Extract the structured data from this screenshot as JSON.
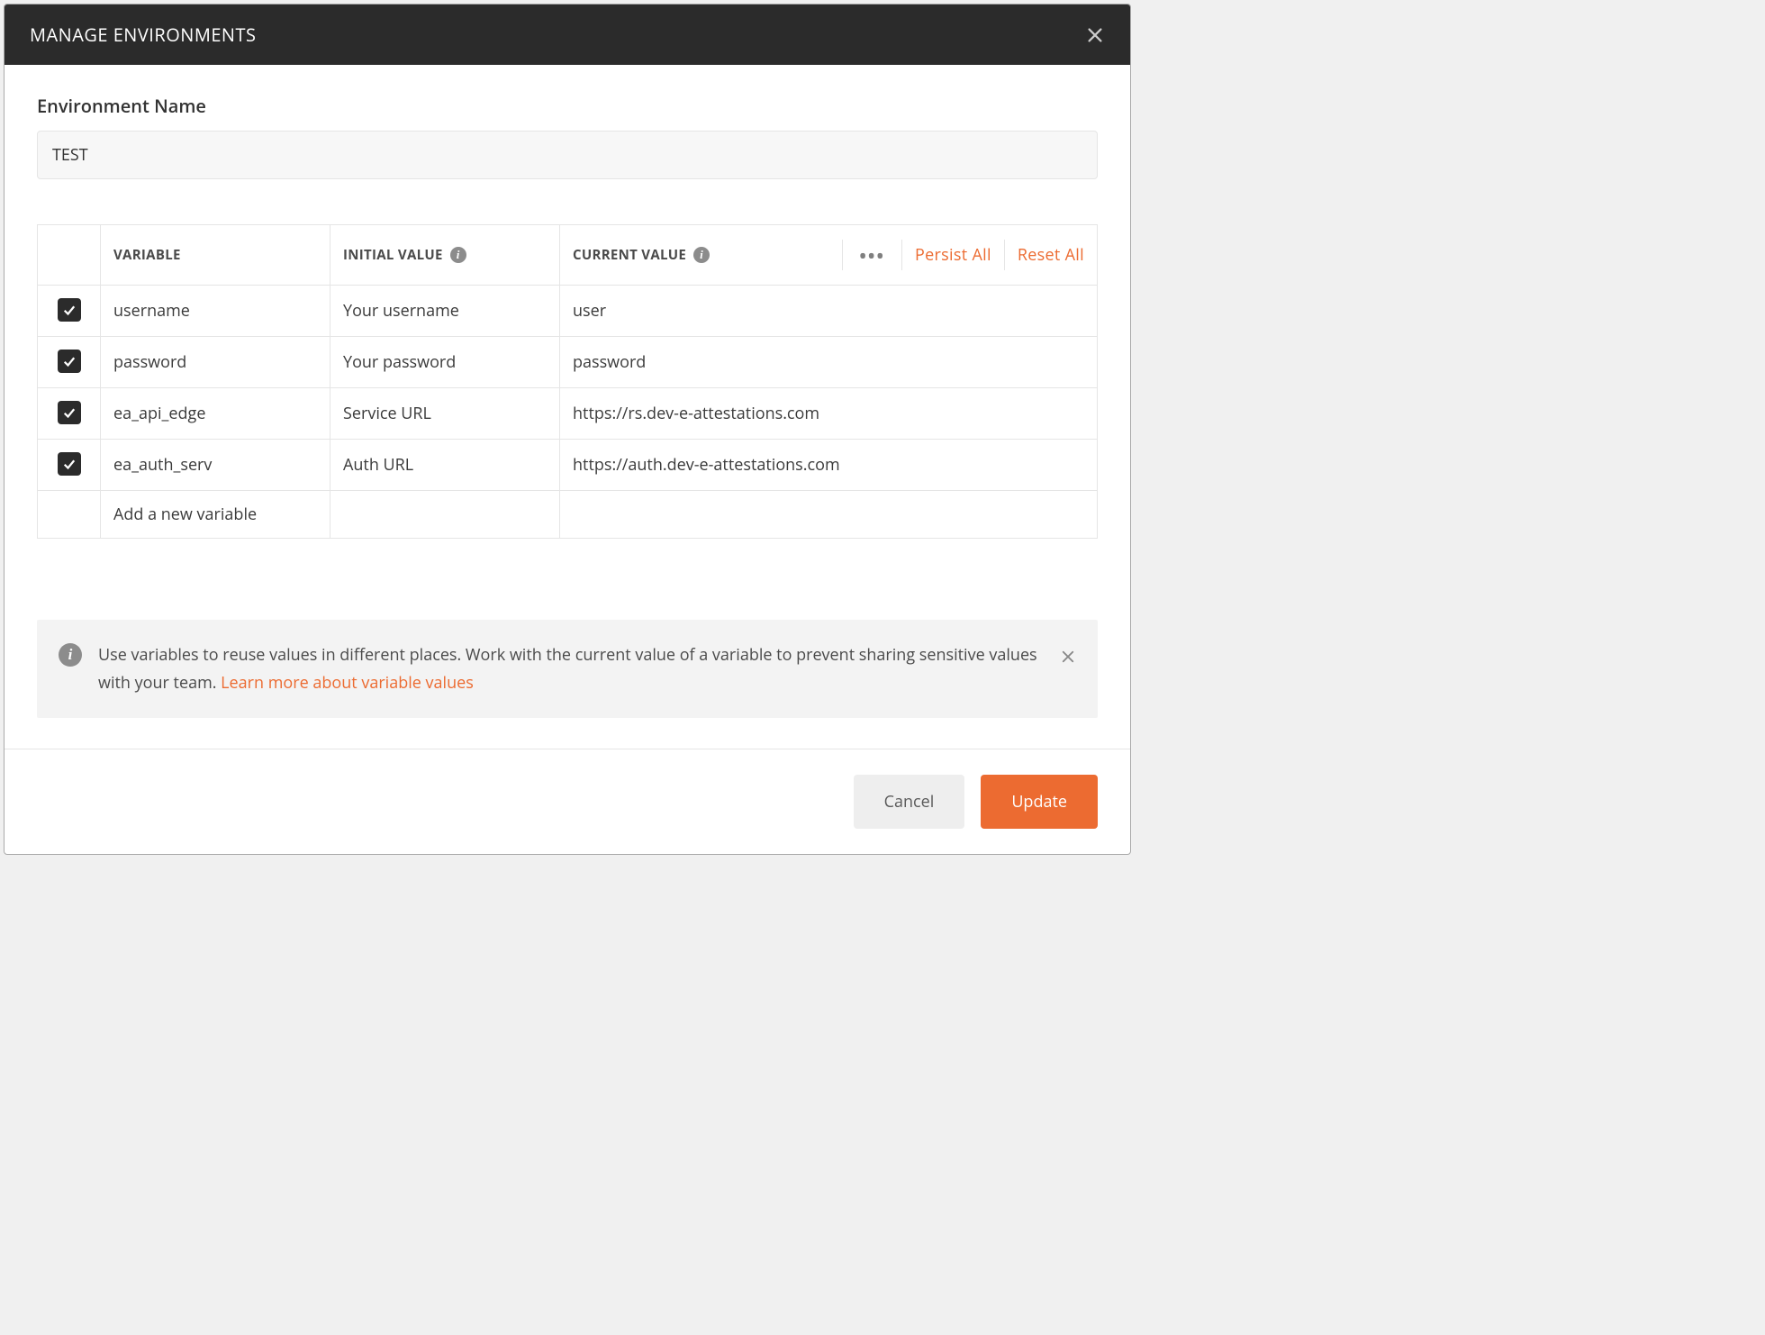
{
  "modal": {
    "title": "MANAGE ENVIRONMENTS"
  },
  "form": {
    "env_name_label": "Environment Name",
    "env_name_value": "TEST"
  },
  "table": {
    "headers": {
      "variable": "VARIABLE",
      "initial": "INITIAL VALUE",
      "current": "CURRENT VALUE"
    },
    "actions": {
      "persist_all": "Persist All",
      "reset_all": "Reset All"
    },
    "rows": [
      {
        "enabled": true,
        "variable": "username",
        "initial": "Your username",
        "current": "user"
      },
      {
        "enabled": true,
        "variable": "password",
        "initial": "Your password",
        "current": "password"
      },
      {
        "enabled": true,
        "variable": "ea_api_edge",
        "initial": "Service URL",
        "current": "https://rs.dev-e-attestations.com"
      },
      {
        "enabled": true,
        "variable": "ea_auth_serv",
        "initial": "Auth URL",
        "current": "https://auth.dev-e-attestations.com"
      }
    ],
    "new_row_placeholder": "Add a new variable"
  },
  "banner": {
    "text": "Use variables to reuse values in different places. Work with the current value of a variable to prevent sharing sensitive values with your team. ",
    "link": "Learn more about variable values"
  },
  "footer": {
    "cancel": "Cancel",
    "update": "Update"
  }
}
